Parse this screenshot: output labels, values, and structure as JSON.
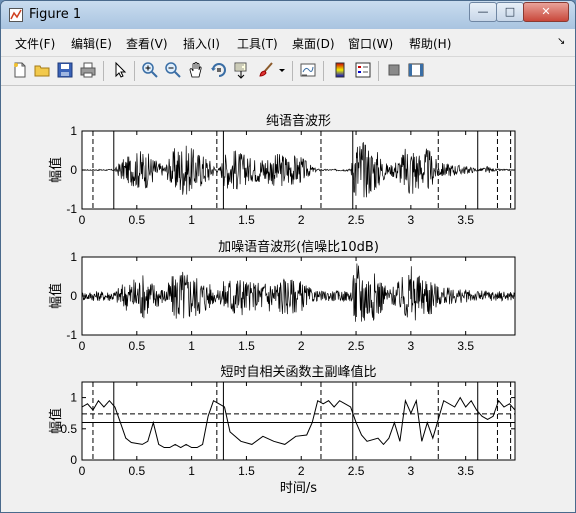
{
  "window": {
    "title": "Figure 1"
  },
  "menu": [
    "文件(F)",
    "编辑(E)",
    "查看(V)",
    "插入(I)",
    "工具(T)",
    "桌面(D)",
    "窗口(W)",
    "帮助(H)"
  ],
  "toolbar_icons": [
    "new-file-icon",
    "open-folder-icon",
    "save-icon",
    "print-icon",
    "pointer-icon",
    "zoom-in-icon",
    "zoom-out-icon",
    "pan-hand-icon",
    "rotate-3d-icon",
    "data-cursor-icon",
    "brush-icon",
    "brush-dropdown-icon",
    "link-plot-icon",
    "colorbar-icon",
    "legend-icon",
    "hide-plot-tools-icon",
    "show-plot-tools-icon"
  ],
  "figure": {
    "xlabel": "时间/s",
    "plots": [
      {
        "title": "纯语音波形",
        "ylabel": "幅值",
        "yticks": [
          "1",
          "0",
          "-1"
        ],
        "xticks": [
          "0",
          "0.5",
          "1",
          "1.5",
          "2",
          "2.5",
          "3",
          "3.5"
        ]
      },
      {
        "title": "加噪语音波形(信噪比10dB)",
        "ylabel": "幅值",
        "yticks": [
          "1",
          "0",
          "-1"
        ],
        "xticks": [
          "0",
          "0.5",
          "1",
          "1.5",
          "2",
          "2.5",
          "3",
          "3.5"
        ]
      },
      {
        "title": "短时自相关函数主副峰值比",
        "ylabel": "幅值",
        "yticks": [
          "1",
          "0.5",
          "0"
        ],
        "xticks": [
          "0",
          "0.5",
          "1",
          "1.5",
          "2",
          "2.5",
          "3",
          "3.5"
        ]
      }
    ]
  },
  "chart_data": [
    {
      "type": "line",
      "title": "纯语音波形",
      "ylabel": "幅值",
      "xlim": [
        0,
        3.95
      ],
      "ylim": [
        -1,
        1
      ],
      "segment_solid_lines_s": [
        0.29,
        1.29,
        2.47,
        3.61
      ],
      "segment_dashed_lines_s": [
        0.1,
        1.23,
        2.18,
        3.25,
        3.79,
        3.91
      ],
      "envelope": {
        "x": [
          0,
          0.3,
          0.35,
          0.45,
          0.55,
          0.65,
          0.75,
          0.85,
          0.9,
          0.95,
          1.05,
          1.15,
          1.2,
          1.25,
          1.3,
          1.4,
          1.55,
          1.7,
          1.85,
          2.0,
          2.1,
          2.15,
          2.25,
          2.45,
          2.5,
          2.6,
          2.7,
          2.8,
          2.9,
          3.0,
          3.1,
          3.15,
          3.25,
          3.4,
          3.55,
          3.62,
          3.7,
          3.75,
          3.95
        ],
        "y": [
          0.01,
          0.02,
          0.25,
          0.4,
          0.55,
          0.35,
          0.1,
          0.6,
          0.7,
          0.65,
          0.5,
          0.35,
          0.15,
          0.03,
          0.45,
          0.55,
          0.3,
          0.4,
          0.45,
          0.35,
          0.1,
          0.03,
          0.02,
          0.03,
          0.95,
          0.7,
          0.5,
          0.1,
          0.35,
          0.8,
          0.4,
          0.6,
          0.2,
          0.15,
          0.08,
          0.02,
          0.1,
          0.03,
          0.01
        ]
      }
    },
    {
      "type": "line",
      "title": "加噪语音波形(信噪比10dB)",
      "ylabel": "幅值",
      "xlim": [
        0,
        3.95
      ],
      "ylim": [
        -1,
        1
      ],
      "noise_floor": 0.12,
      "envelope": {
        "x": [
          0,
          0.3,
          0.35,
          0.45,
          0.55,
          0.65,
          0.75,
          0.85,
          0.9,
          0.95,
          1.05,
          1.15,
          1.2,
          1.25,
          1.3,
          1.4,
          1.55,
          1.7,
          1.85,
          2.0,
          2.1,
          2.15,
          2.25,
          2.45,
          2.5,
          2.6,
          2.7,
          2.8,
          2.9,
          3.0,
          3.1,
          3.15,
          3.25,
          3.4,
          3.55,
          3.62,
          3.7,
          3.75,
          3.95
        ],
        "y": [
          0.12,
          0.14,
          0.3,
          0.45,
          0.6,
          0.4,
          0.18,
          0.65,
          0.75,
          0.7,
          0.55,
          0.4,
          0.2,
          0.14,
          0.5,
          0.6,
          0.35,
          0.45,
          0.5,
          0.4,
          0.16,
          0.13,
          0.13,
          0.14,
          1.0,
          0.75,
          0.55,
          0.18,
          0.4,
          0.85,
          0.45,
          0.65,
          0.25,
          0.2,
          0.15,
          0.13,
          0.15,
          0.13,
          0.12
        ]
      }
    },
    {
      "type": "line",
      "title": "短时自相关函数主副峰值比",
      "ylabel": "幅值",
      "xlabel": "时间/s",
      "xlim": [
        0,
        3.95
      ],
      "ylim": [
        0,
        1.25
      ],
      "thresholds": [
        0.74,
        0.6
      ],
      "segment_solid_lines_s": [
        0.29,
        1.29,
        2.47,
        3.61
      ],
      "segment_dashed_lines_s": [
        0.1,
        1.23,
        2.18,
        3.25,
        3.79,
        3.91
      ],
      "x": [
        0,
        0.05,
        0.1,
        0.15,
        0.2,
        0.25,
        0.3,
        0.35,
        0.4,
        0.45,
        0.55,
        0.6,
        0.65,
        0.7,
        0.75,
        0.8,
        0.85,
        0.9,
        0.95,
        1.0,
        1.05,
        1.1,
        1.15,
        1.2,
        1.25,
        1.3,
        1.35,
        1.45,
        1.55,
        1.65,
        1.75,
        1.85,
        1.95,
        2.05,
        2.1,
        2.15,
        2.2,
        2.25,
        2.3,
        2.35,
        2.4,
        2.45,
        2.5,
        2.55,
        2.6,
        2.7,
        2.75,
        2.8,
        2.85,
        2.9,
        2.95,
        3.0,
        3.05,
        3.1,
        3.15,
        3.2,
        3.3,
        3.4,
        3.45,
        3.5,
        3.55,
        3.6,
        3.65,
        3.7,
        3.75,
        3.8,
        3.85,
        3.9,
        3.95
      ],
      "y": [
        0.85,
        0.9,
        0.8,
        0.95,
        0.85,
        0.95,
        0.85,
        0.6,
        0.35,
        0.28,
        0.25,
        0.3,
        0.6,
        0.25,
        0.2,
        0.2,
        0.25,
        0.2,
        0.25,
        0.2,
        0.2,
        0.25,
        0.7,
        0.95,
        0.9,
        0.85,
        0.45,
        0.3,
        0.25,
        0.38,
        0.3,
        0.25,
        0.38,
        0.4,
        0.6,
        0.95,
        0.9,
        0.95,
        0.85,
        0.95,
        0.9,
        0.85,
        0.6,
        0.4,
        0.3,
        0.35,
        0.25,
        0.35,
        0.6,
        0.3,
        0.95,
        0.75,
        0.95,
        0.3,
        0.6,
        0.35,
        0.95,
        0.85,
        1.0,
        0.85,
        0.95,
        0.8,
        0.7,
        0.65,
        0.7,
        0.95,
        0.85,
        0.9,
        0.8
      ]
    }
  ]
}
